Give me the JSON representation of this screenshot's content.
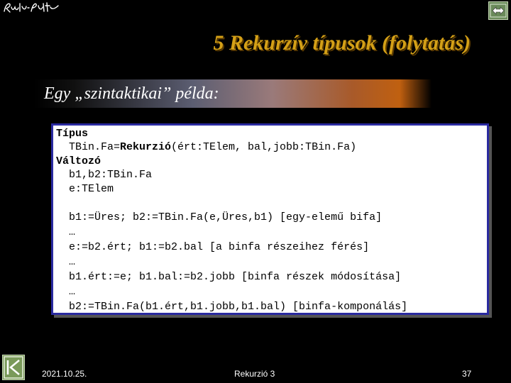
{
  "header": {
    "signature": "Rlaki Péter",
    "nav_icon": "double-arrow-icon"
  },
  "slide": {
    "title": "5 Rekurzív típusok (folytatás)",
    "subtitle": "Egy „szintaktikai” példa:"
  },
  "code": {
    "line1": "Típus",
    "line2a": "  TBin.Fa=",
    "line2b": "Rekurzió",
    "line2c": "(ért:TElem, bal,jobb:TBin.Fa)",
    "line3": "Változó",
    "line4": "  b1,b2:TBin.Fa",
    "line5": "  e:TElem",
    "line6": "  b1:=Üres; b2:=TBin.Fa(e,Üres,b1) [egy-elemű bifa]",
    "line7": "  …",
    "line8": "  e:=b2.ért; b1:=b2.bal [a binfa részeihez férés]",
    "line9": "  …",
    "line10": "  b1.ért:=e; b1.bal:=b2.jobb [binfa részek módosítása]",
    "line11": "  …",
    "line12": "  b2:=TBin.Fa(b1.ért,b1.jobb,b1.bal) [binfa-komponálás]"
  },
  "footer": {
    "date": "2021.10.25.",
    "center": "Rekurzió 3",
    "page": "37",
    "nav_icon": "back-to-start-icon"
  },
  "colors": {
    "title": "#d4a017",
    "code_border": "#2a2aa0",
    "nav_button": "#7a9a5a"
  }
}
